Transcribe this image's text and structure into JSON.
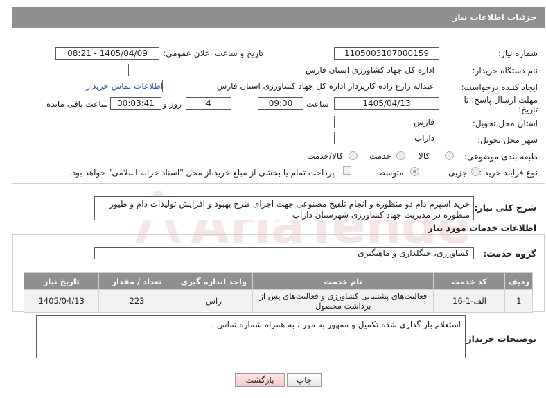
{
  "header": {
    "title": "جزئیات اطلاعات نیاز"
  },
  "form": {
    "need_number_label": "شماره نیاز:",
    "need_number": "1105003107000159",
    "announce_label": "تاریخ و ساعت اعلان عمومی:",
    "announce_value": "1405/04/09 - 08:21",
    "buyer_org_label": "نام دستگاه خریدار:",
    "buyer_org": "اداره کل جهاد کشاورزی استان فارس",
    "creator_label": "ایجاد کننده درخواست:",
    "creator": "عبداله زارع زاده کارپرداز اداره کل جهاد کشاورزی استان فارس",
    "contact_link": "اطلاعات تماس خریدار",
    "deadline_label_1": "مهلت ارسال پاسخ: تا",
    "deadline_label_2": "تاریخ:",
    "deadline_date": "1405/04/13",
    "time_label": "ساعت",
    "deadline_time": "09:00",
    "days_value": "4",
    "days_label": "روز و",
    "remaining_time": "00:03:41",
    "remaining_label": "ساعت باقی مانده",
    "province_label": "استان محل تحویل:",
    "province": "فارس",
    "city_label": "شهر محل تحویل:",
    "city": "داراب",
    "category_label": "طبقه بندی موضوعی:",
    "category_options": [
      "کالا",
      "خدمت",
      "کالا/خدمت"
    ],
    "process_label": "نوع فرآیند خرید :",
    "process_options": [
      "جزیی",
      "متوسط"
    ],
    "payment_note": "پرداخت تمام یا بخشی از مبلغ خرید،از محل \"اسناد خزانه اسلامی\" خواهد بود."
  },
  "summary": {
    "label": "شرح کلی نیاز:",
    "text": "خرید اسپرم دام دو منظوره و انجام تلقیح مصنوعی  جهت اجرای طرح بهبود و افزایش تولیدات دام و طیور منظوره در مدیریت جهاد کشاورزی شهرستان داراب"
  },
  "services": {
    "section_title": "اطلاعات خدمات مورد نیاز",
    "group_label": "گروه خدمت:",
    "group_value": "کشاورزی، جنگلداری و ماهیگیری",
    "columns": [
      "ردیف",
      "کد خدمت",
      "نام خدمت",
      "واحد اندازه گیری",
      "تعداد / مقدار",
      "تاریخ نیاز"
    ],
    "rows": [
      [
        "1",
        "الف-1-16",
        "فعالیت‌های پشتیبانی کشاورزی و فعالیت‌های پس از برداشت محصول",
        "راس",
        "223",
        "1405/04/13"
      ]
    ]
  },
  "buyer_notes": {
    "label": "توضیحات خریدار:",
    "text": "استعلام بار گذاری شده تکمیل و ممهور به مهر ، به همراه شماره تماس ."
  },
  "buttons": {
    "print": "چاپ",
    "back": "بازگشت"
  },
  "watermark": {
    "text": "AriaTender.neT"
  },
  "colors": {
    "header_bg": "#8f8f8f",
    "link": "#2a55b3",
    "back_button": "#f5caca"
  }
}
